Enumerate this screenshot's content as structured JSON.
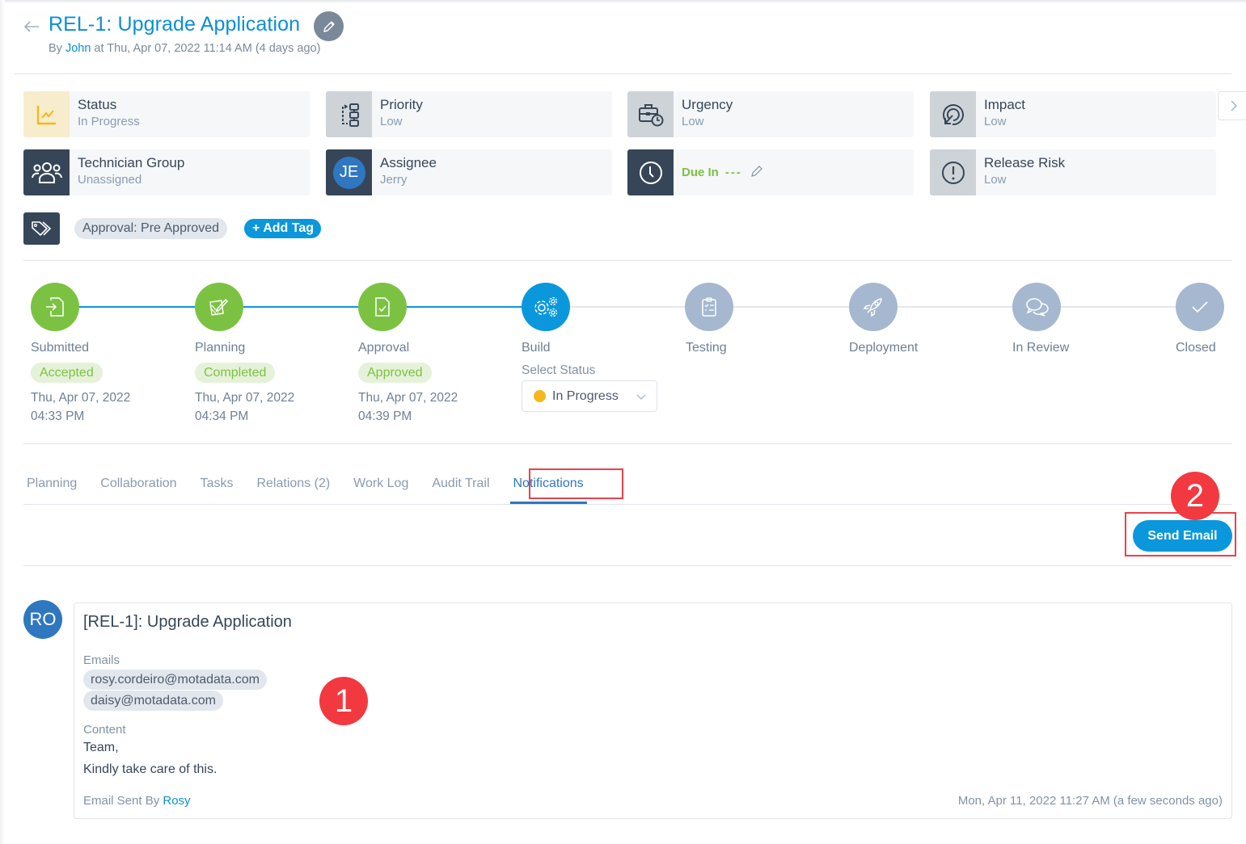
{
  "header": {
    "title": "REL-1: Upgrade Application",
    "byline_prefix": "By ",
    "author": "John",
    "byline_suffix": " at Thu, Apr 07, 2022 11:14 AM (4 days ago)"
  },
  "cards": [
    {
      "label": "Status",
      "value": "In Progress",
      "icon": "chart-line-icon"
    },
    {
      "label": "Priority",
      "value": "Low",
      "icon": "priority-flow-icon"
    },
    {
      "label": "Urgency",
      "value": "Low",
      "icon": "briefcase-clock-icon"
    },
    {
      "label": "Impact",
      "value": "Low",
      "icon": "target-cursor-icon"
    },
    {
      "label": "Technician Group",
      "value": "Unassigned",
      "icon": "users-group-icon"
    },
    {
      "label": "Assignee",
      "value": "Jerry",
      "avatar_initials": "JE"
    },
    {
      "label": "Due In",
      "value": "---",
      "icon": "clock-icon"
    },
    {
      "label": "Release Risk",
      "value": "Low",
      "icon": "alert-circle-icon"
    }
  ],
  "tags": {
    "items": [
      "Approval: Pre Approved"
    ],
    "add_label": "+ Add Tag"
  },
  "stepper": {
    "steps": [
      {
        "name": "Submitted",
        "state": "done",
        "badge": "Accepted",
        "date": "Thu, Apr 07, 2022",
        "time": "04:33 PM"
      },
      {
        "name": "Planning",
        "state": "done",
        "badge": "Completed",
        "date": "Thu, Apr 07, 2022",
        "time": "04:34 PM"
      },
      {
        "name": "Approval",
        "state": "done",
        "badge": "Approved",
        "date": "Thu, Apr 07, 2022",
        "time": "04:39 PM"
      },
      {
        "name": "Build",
        "state": "current"
      },
      {
        "name": "Testing",
        "state": "pending"
      },
      {
        "name": "Deployment",
        "state": "pending"
      },
      {
        "name": "In Review",
        "state": "pending"
      },
      {
        "name": "Closed",
        "state": "pending"
      }
    ],
    "select_status_label": "Select Status",
    "selected_status": "In Progress",
    "selected_status_color": "#f4b81c"
  },
  "tabs": [
    {
      "label": "Planning"
    },
    {
      "label": "Collaboration"
    },
    {
      "label": "Tasks"
    },
    {
      "label": "Relations (2)"
    },
    {
      "label": "Work Log"
    },
    {
      "label": "Audit Trail"
    },
    {
      "label": "Notifications",
      "active": true
    }
  ],
  "actions": {
    "send_email": "Send Email"
  },
  "annotations": {
    "marker_1": "1",
    "marker_2": "2"
  },
  "notification": {
    "avatar_initials": "RO",
    "subject": "[REL-1]: Upgrade Application",
    "emails_label": "Emails",
    "emails": [
      "rosy.cordeiro@motadata.com",
      "daisy@motadata.com"
    ],
    "content_label": "Content",
    "content_lines": [
      "Team,",
      "Kindly take care of this."
    ],
    "sent_by_prefix": "Email Sent By ",
    "sent_by": "Rosy",
    "timestamp": "Mon, Apr 11, 2022 11:27 AM (a few seconds ago)"
  },
  "colors": {
    "accent": "#0a97dc",
    "done": "#7cc242",
    "pending": "#a5b8cf",
    "highlight": "#e8434a"
  }
}
